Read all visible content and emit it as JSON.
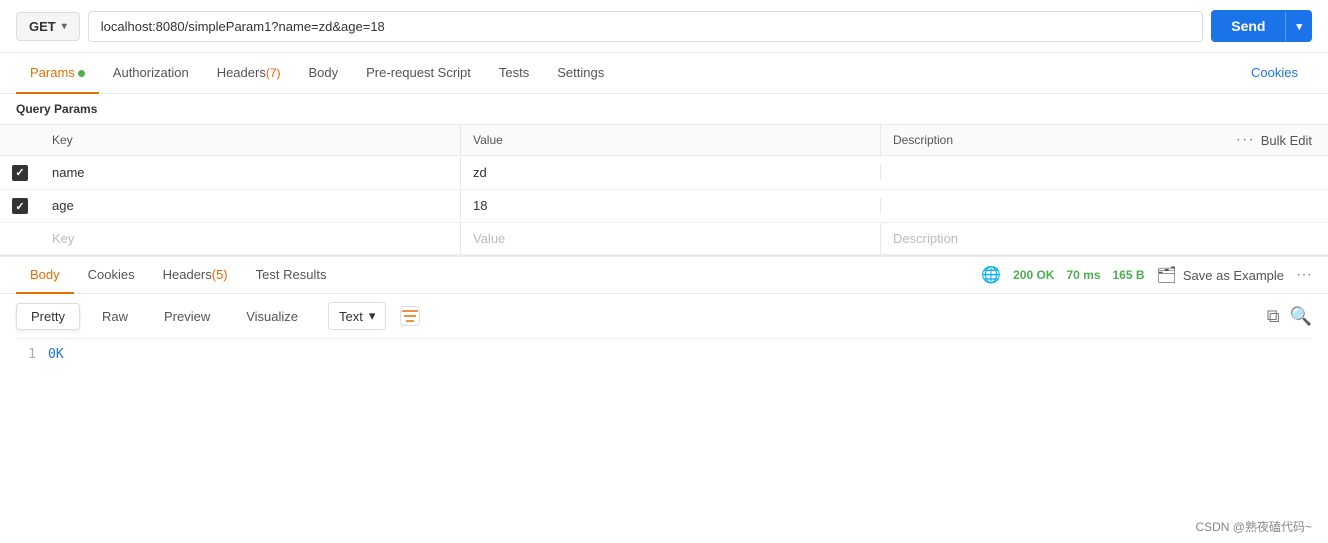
{
  "urlBar": {
    "method": "GET",
    "url": "localhost:8080/simpleParam1?name=zd&age=18",
    "sendLabel": "Send"
  },
  "tabs": [
    {
      "id": "params",
      "label": "Params",
      "dot": true,
      "active": true
    },
    {
      "id": "authorization",
      "label": "Authorization",
      "active": false
    },
    {
      "id": "headers",
      "label": "Headers",
      "count": "(7)",
      "active": false
    },
    {
      "id": "body",
      "label": "Body",
      "active": false
    },
    {
      "id": "prerequest",
      "label": "Pre-request Script",
      "active": false
    },
    {
      "id": "tests",
      "label": "Tests",
      "active": false
    },
    {
      "id": "settings",
      "label": "Settings",
      "active": false
    }
  ],
  "cookiesTab": "Cookies",
  "queryParams": {
    "label": "Query Params",
    "columns": {
      "key": "Key",
      "value": "Value",
      "description": "Description",
      "bulkEdit": "Bulk Edit"
    },
    "rows": [
      {
        "checked": true,
        "key": "name",
        "value": "zd",
        "description": ""
      },
      {
        "checked": true,
        "key": "age",
        "value": "18",
        "description": ""
      },
      {
        "checked": false,
        "key": "",
        "value": "",
        "description": ""
      }
    ],
    "placeholders": {
      "key": "Key",
      "value": "Value",
      "description": "Description"
    }
  },
  "responseTabs": [
    {
      "id": "body",
      "label": "Body",
      "active": true
    },
    {
      "id": "cookies",
      "label": "Cookies",
      "active": false
    },
    {
      "id": "headers",
      "label": "Headers",
      "count": "(5)",
      "active": false
    },
    {
      "id": "testResults",
      "label": "Test Results",
      "active": false
    }
  ],
  "statusBar": {
    "status": "200 OK",
    "time": "70 ms",
    "size": "165 B",
    "saveExample": "Save as Example"
  },
  "formatButtons": [
    {
      "id": "pretty",
      "label": "Pretty",
      "active": true
    },
    {
      "id": "raw",
      "label": "Raw",
      "active": false
    },
    {
      "id": "preview",
      "label": "Preview",
      "active": false
    },
    {
      "id": "visualize",
      "label": "Visualize",
      "active": false
    }
  ],
  "textDropdown": "Text",
  "codeLines": [
    {
      "num": "1",
      "content": "0K"
    }
  ],
  "watermark": "CSDN @熟夜磕代码~"
}
